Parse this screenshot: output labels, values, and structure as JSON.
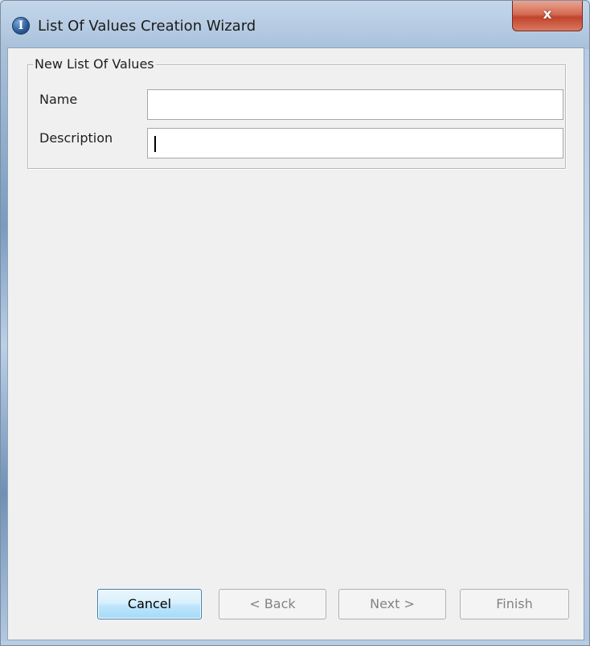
{
  "window": {
    "title": "List Of Values Creation Wizard",
    "icon_glyph": "I",
    "close_glyph": "x"
  },
  "form": {
    "group_title": "New List Of Values",
    "name_label": "Name",
    "name_value": "",
    "description_label": "Description",
    "description_value": ""
  },
  "buttons": {
    "cancel": "Cancel",
    "back": "< Back",
    "next": "Next >",
    "finish": "Finish"
  },
  "colors": {
    "accent_button_border": "#3c7fb1",
    "close_button": "#c0442b",
    "dialog_background": "#f0f0f0"
  }
}
